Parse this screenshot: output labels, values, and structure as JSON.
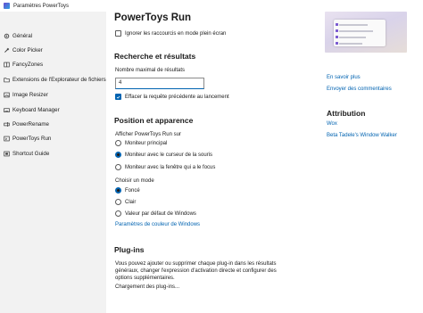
{
  "window": {
    "title": "Paramètres PowerToys"
  },
  "sidebar": {
    "items": [
      {
        "label": "Général",
        "icon": "gear-icon"
      },
      {
        "label": "Color Picker",
        "icon": "color-picker-icon"
      },
      {
        "label": "FancyZones",
        "icon": "fancyzones-icon"
      },
      {
        "label": "Extensions de l'Explorateur de fichiers",
        "icon": "file-explorer-icon"
      },
      {
        "label": "Image Resizer",
        "icon": "image-resizer-icon"
      },
      {
        "label": "Keyboard Manager",
        "icon": "keyboard-icon"
      },
      {
        "label": "PowerRename",
        "icon": "rename-icon"
      },
      {
        "label": "PowerToys Run",
        "icon": "run-icon"
      },
      {
        "label": "Shortcut Guide",
        "icon": "shortcut-guide-icon"
      }
    ]
  },
  "main": {
    "title": "PowerToys Run",
    "ignore_fullscreen_label": "Ignorer les raccourcis en mode plein écran",
    "search_section": {
      "title": "Recherche et résultats",
      "max_results_label": "Nombre maximal de résultats",
      "max_results_value": "4",
      "clear_query_label": "Effacer la requête précédente au lancement"
    },
    "position_section": {
      "title": "Position et apparence",
      "show_on_label": "Afficher PowerToys Run sur",
      "options": [
        "Moniteur principal",
        "Moniteur avec le curseur de la souris",
        "Moniteur avec la fenêtre qui a le focus"
      ],
      "mode_label": "Choisir un mode",
      "modes": [
        "Foncé",
        "Clair",
        "Valeur par défaut de Windows"
      ],
      "color_settings_link": "Paramètres de couleur de Windows"
    },
    "plugins_section": {
      "title": "Plug-ins",
      "description": "Vous pouvez ajouter ou supprimer chaque plug-in dans les résultats généraux, changer l'expression d'activation directe et configurer des options supplémentaires.",
      "loading": "Chargement des plug-ins..."
    }
  },
  "right": {
    "learn_more": "En savoir plus",
    "send_feedback": "Envoyer des commentaires",
    "attribution_title": "Attribution",
    "attribution_links": [
      "Wox",
      "Beta Tadele's Window Walker"
    ]
  },
  "colors": {
    "accent": "#0063b1",
    "sidebar_bg": "#f2f2f2"
  }
}
